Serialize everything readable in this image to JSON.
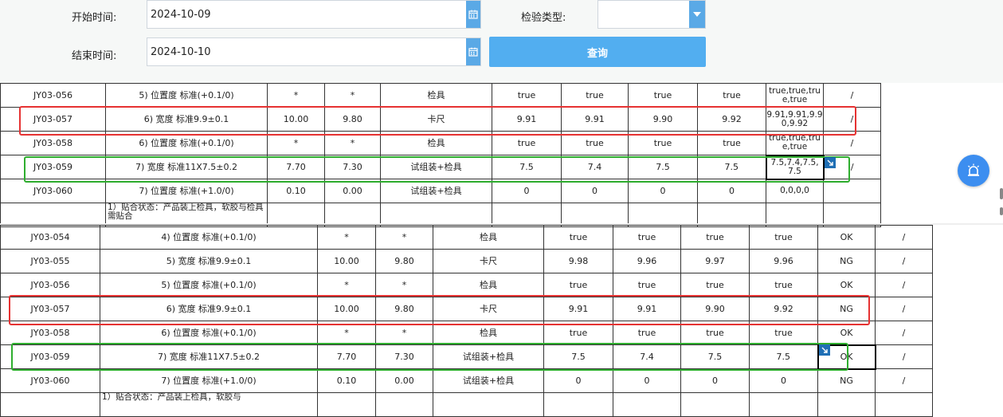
{
  "form": {
    "start_label": "开始时间:",
    "start_value": "2024-10-09",
    "end_label": "结束时间:",
    "end_value": "2024-10-10",
    "type_label": "检验类型:",
    "type_value": "",
    "query_label": "查询"
  },
  "table_top": {
    "rows": [
      [
        "JY03-056",
        "5) 位置度 标准(+0.1/0)",
        "*",
        "*",
        "检具",
        "true",
        "true",
        "true",
        "true",
        "true,true,true,true",
        "/"
      ],
      [
        "JY03-057",
        "6) 宽度 标准9.9±0.1",
        "10.00",
        "9.80",
        "卡尺",
        "9.91",
        "9.91",
        "9.90",
        "9.92",
        "9.91,9.91,9.90,9.92",
        "/"
      ],
      [
        "JY03-058",
        "6) 位置度 标准(+0.1/0)",
        "*",
        "*",
        "检具",
        "true",
        "true",
        "true",
        "true",
        "true,true,true,true",
        "/"
      ],
      [
        "JY03-059",
        "7) 宽度 标准11X7.5±0.2",
        "7.70",
        "7.30",
        "试组装+检具",
        "7.5",
        "7.4",
        "7.5",
        "7.5",
        "7.5,7.4,7.5,7.5",
        "/"
      ],
      [
        "JY03-060",
        "7) 位置度 标准(+1.0/0)",
        "0.10",
        "0.00",
        "试组装+检具",
        "0",
        "0",
        "0",
        "0",
        "0,0,0,0",
        ""
      ],
      [
        "",
        "1）贴合状态：产品装上检具，软胶与检具需贴合",
        "",
        "",
        "",
        "",
        "",
        "",
        "",
        "",
        ""
      ]
    ]
  },
  "table_bottom": {
    "rows": [
      [
        "JY03-054",
        "4) 位置度 标准(+0.1/0)",
        "*",
        "*",
        "检具",
        "true",
        "true",
        "true",
        "true",
        "OK",
        "/"
      ],
      [
        "JY03-055",
        "5) 宽度 标准9.9±0.1",
        "10.00",
        "9.80",
        "卡尺",
        "9.98",
        "9.96",
        "9.97",
        "9.96",
        "NG",
        "/"
      ],
      [
        "JY03-056",
        "5) 位置度 标准(+0.1/0)",
        "*",
        "*",
        "检具",
        "true",
        "true",
        "true",
        "true",
        "OK",
        "/"
      ],
      [
        "JY03-057",
        "6) 宽度 标准9.9±0.1",
        "10.00",
        "9.80",
        "卡尺",
        "9.91",
        "9.91",
        "9.90",
        "9.92",
        "NG",
        "/"
      ],
      [
        "JY03-058",
        "6) 位置度 标准(+0.1/0)",
        "*",
        "*",
        "检具",
        "true",
        "true",
        "true",
        "true",
        "OK",
        "/"
      ],
      [
        "JY03-059",
        "7) 宽度 标准11X7.5±0.2",
        "7.70",
        "7.30",
        "试组装+检具",
        "7.5",
        "7.4",
        "7.5",
        "7.5",
        "OK",
        "/"
      ],
      [
        "JY03-060",
        "7) 位置度 标准(+1.0/0)",
        "0.10",
        "0.00",
        "试组装+检具",
        "0",
        "0",
        "0",
        "0",
        "NG",
        "/"
      ],
      [
        "",
        "1）贴合状态：产品装上检具，软胶与",
        "",
        "",
        "",
        "",
        "",
        "",
        "",
        "",
        ""
      ]
    ]
  },
  "icons": {
    "calendar": "calendar-icon",
    "dropdown": "caret-down-icon",
    "expand": "expand-arrow-icon",
    "alarm": "alarm-icon"
  },
  "colors": {
    "accent": "#52aef0",
    "highlight_red": "#e63232",
    "highlight_green": "#2fae2f",
    "fab": "#3c8ef0"
  }
}
